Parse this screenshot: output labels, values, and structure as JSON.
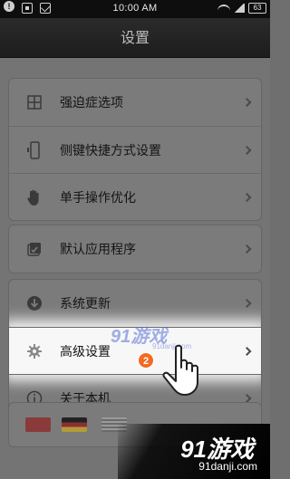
{
  "status_bar": {
    "time": "10:00 AM",
    "battery": "63",
    "left_icons": [
      "warning-icon",
      "usb-icon",
      "mail-icon"
    ],
    "right_icons": [
      "wifi-icon",
      "signal-icon",
      "battery-icon"
    ]
  },
  "header": {
    "title": "设置"
  },
  "groups": [
    {
      "items": [
        {
          "label": "强迫症选项",
          "icon": "grid-icon"
        },
        {
          "label": "侧键快捷方式设置",
          "icon": "phone-side-key-icon"
        },
        {
          "label": "单手操作优化",
          "icon": "hand-icon"
        }
      ]
    },
    {
      "items": [
        {
          "label": "默认应用程序",
          "icon": "app-check-icon"
        }
      ]
    },
    {
      "items": [
        {
          "label": "系统更新",
          "icon": "download-icon"
        },
        {
          "label": "高级设置",
          "icon": "gear-icon",
          "highlighted": true
        },
        {
          "label": "关于本机",
          "icon": "info-icon"
        }
      ]
    }
  ],
  "step_badge": "2",
  "language_flags": [
    "china-flag",
    "germany-flag",
    "usa-flag"
  ],
  "watermark": {
    "top_logo": "91游戏",
    "top_sub": "91danji.com",
    "bottom_logo": "91游戏",
    "bottom_sub": "91danji.com"
  },
  "colors": {
    "highlight": "#f7f7f7",
    "badge": "#f26a21",
    "watermark_blue": "#5a6fd6"
  }
}
